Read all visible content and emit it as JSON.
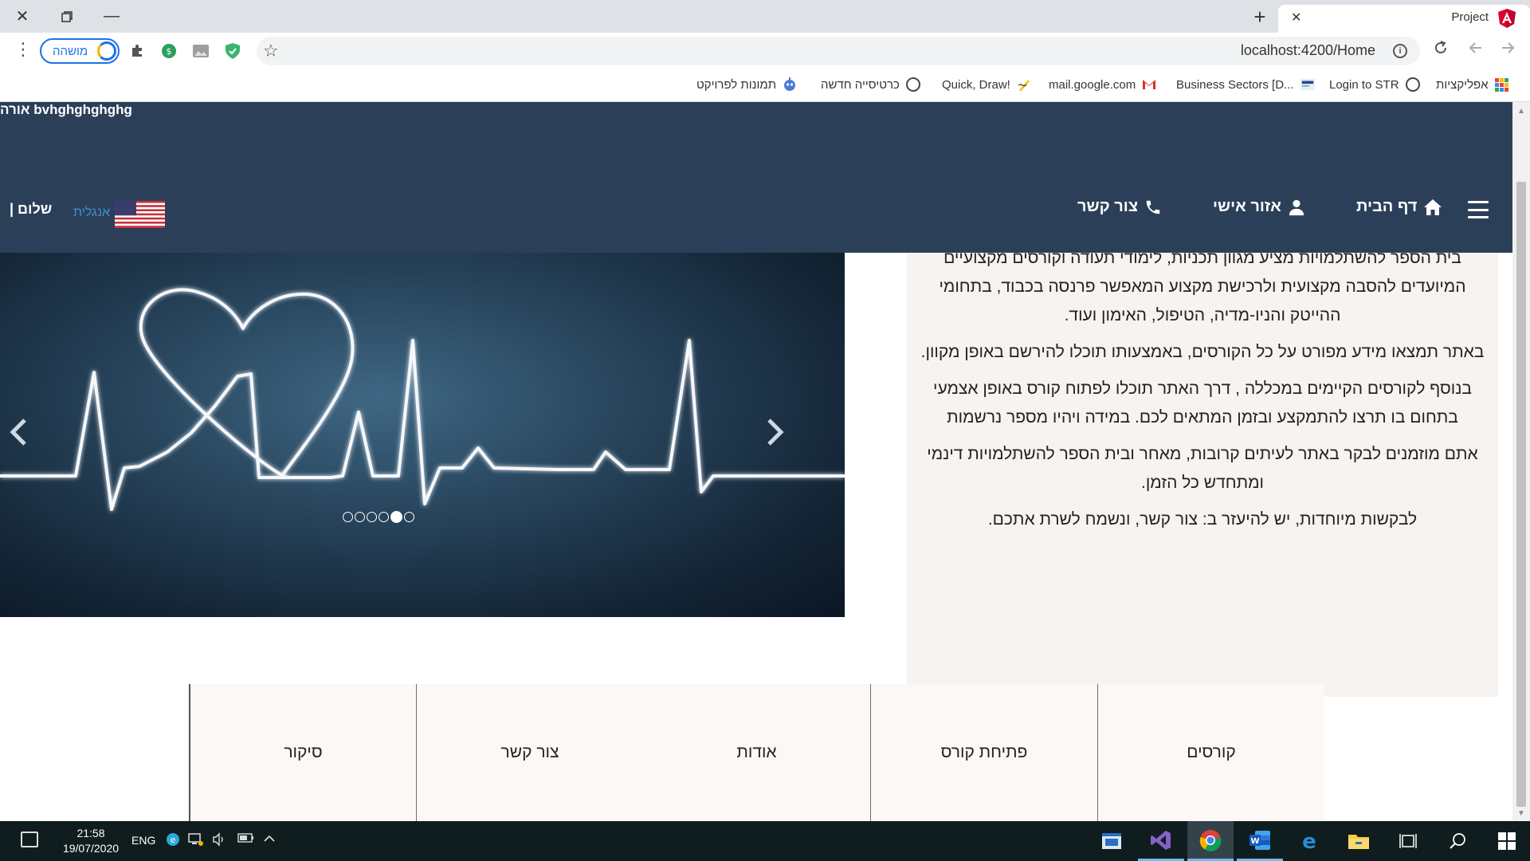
{
  "browser": {
    "tab_title": "Project",
    "url": "localhost:4200/Home",
    "profile_label": "מושהה",
    "bookmarks": [
      {
        "label": "אפליקציות",
        "icon": "apps-grid-icon"
      },
      {
        "label": "Login to STR",
        "icon": "globe-icon"
      },
      {
        "label": "Business Sectors [D...",
        "icon": "dnb-icon"
      },
      {
        "label": "mail.google.com",
        "icon": "gmail-icon"
      },
      {
        "label": "Quick, Draw!",
        "icon": "quickdraw-icon"
      },
      {
        "label": "כרטיסייה חדשה",
        "icon": "globe-icon"
      },
      {
        "label": "תמונות לפרויקט",
        "icon": "robot-icon"
      }
    ]
  },
  "site": {
    "header_text": "אורה bvhghghghghg",
    "greeting": "| שלום",
    "language_label": "אנגלית",
    "nav": {
      "home": "דף הבית",
      "personal_area": "אזור אישי",
      "contact": "צור קשר"
    },
    "carousel": {
      "slide_count": 6,
      "active_index": 4
    },
    "about_paragraphs": [
      "בית הספר להשתלמויות מציע מגוון תכניות, לימודי תעודה וקורסים מקצועיים המיועדים להסבה מקצועית ולרכישת מקצוע המאפשר פרנסה בכבוד, בתחומי ההייטק והניו-מדיה, הטיפול, האימון ועוד.",
      "באתר תמצאו מידע מפורט על כל הקורסים, באמצעותו תוכלו להירשם באופן מקוון.",
      "בנוסף לקורסים הקיימים במכללה , דרך האתר תוכלו לפתוח קורס באופן אצמעי בתחום בו תרצו להתמקצע ובזמן המתאים לכם. במידה ויהיו מספר נרשמות",
      "אתם מוזמנים לבקר באתר לעיתים קרובות, מאחר ובית הספר להשתלמויות דינמי ומתחדש כל הזמן.",
      "לבקשות מיוחדות, יש להיעזר ב: צור קשר, ונשמח לשרת אתכם."
    ],
    "footer_links": [
      "קורסים",
      "פתיחת קורס",
      "אודות",
      "צור קשר",
      "סיקור"
    ]
  },
  "taskbar": {
    "time": "21:58",
    "date": "19/07/2020",
    "language": "ENG"
  },
  "colors": {
    "header_bg": "#2b4058",
    "about_bg": "#f6f3f1",
    "footer_bg": "#fcf8f6",
    "link_blue": "#3e8ed0",
    "taskbar_bg": "#101d1e"
  }
}
